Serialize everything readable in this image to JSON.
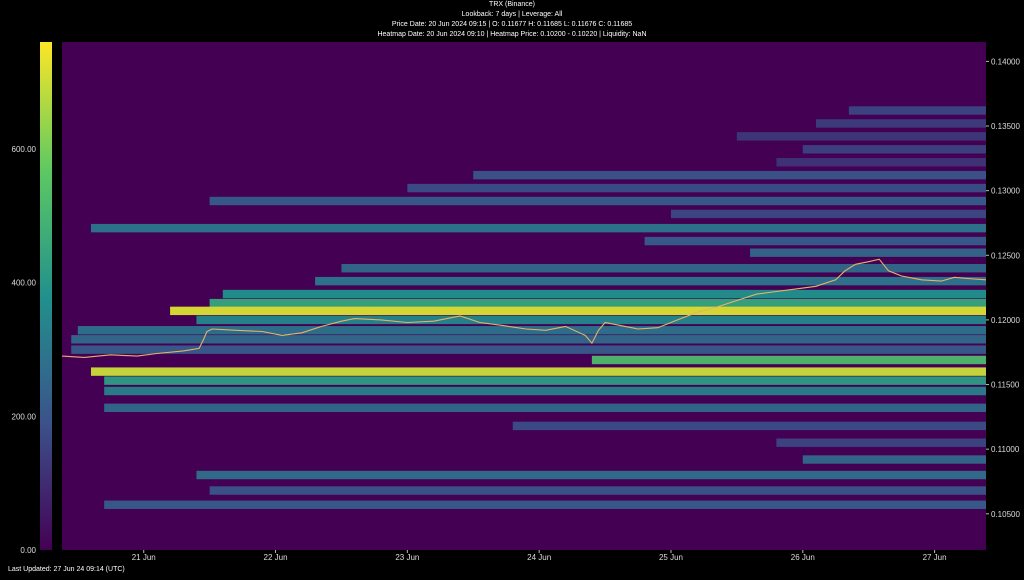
{
  "header": {
    "title": "TRX (Binance)",
    "subtitle": "Lookback: 7 days | Leverage: All",
    "price_line": "Price Date: 20 Jun 2024 09:15 | O: 0.11677 H: 0.11685 L: 0.11676 C: 0.11685",
    "heatmap_line": "Heatmap Date: 20 Jun 2024 09:10 | Heatmap Price: 0.10200 - 0.10220 | Liquidity: NaN"
  },
  "footer": {
    "last_updated": "Last Updated: 27 Jun 24 09:14 (UTC)"
  },
  "colors": {
    "background": "#440154",
    "price_line": "#e8b26a",
    "panel": "#000000"
  },
  "chart_data": {
    "type": "heatmap",
    "title": "TRX (Binance)",
    "xlabel": "",
    "ylabel": "",
    "x_ticks": [
      "21 Jun",
      "22 Jun",
      "23 Jun",
      "24 Jun",
      "25 Jun",
      "26 Jun",
      "27 Jun"
    ],
    "x_range_days": [
      20.38,
      27.39
    ],
    "ylim": [
      0.1022,
      0.1415
    ],
    "y_ticks": [
      "0.14000",
      "0.13500",
      "0.13000",
      "0.12500",
      "0.12000",
      "0.11500",
      "0.11000",
      "0.10500"
    ],
    "colorbar": {
      "range": [
        0,
        760
      ],
      "ticks": [
        "0.00",
        "200.00",
        "400.00",
        "600.00"
      ],
      "colormap": "viridis"
    },
    "price_series": {
      "x": [
        20.38,
        20.55,
        20.75,
        20.95,
        21.1,
        21.3,
        21.42,
        21.45,
        21.48,
        21.52,
        21.7,
        21.9,
        22.05,
        22.2,
        22.35,
        22.5,
        22.6,
        22.8,
        23.0,
        23.2,
        23.4,
        23.55,
        23.7,
        23.9,
        24.05,
        24.2,
        24.35,
        24.4,
        24.45,
        24.5,
        24.6,
        24.75,
        24.9,
        25.05,
        25.2,
        25.35,
        25.5,
        25.65,
        25.8,
        25.95,
        26.1,
        26.25,
        26.32,
        26.4,
        26.5,
        26.58,
        26.65,
        26.75,
        26.9,
        27.05,
        27.15,
        27.25,
        27.39
      ],
      "y": [
        0.1172,
        0.1171,
        0.1173,
        0.1172,
        0.1174,
        0.1176,
        0.1178,
        0.1184,
        0.1191,
        0.1193,
        0.1192,
        0.1191,
        0.1188,
        0.119,
        0.1195,
        0.1199,
        0.1201,
        0.12,
        0.1198,
        0.1199,
        0.1203,
        0.1198,
        0.1196,
        0.1193,
        0.1192,
        0.1195,
        0.1188,
        0.1182,
        0.1192,
        0.1198,
        0.1196,
        0.1193,
        0.1194,
        0.12,
        0.1206,
        0.121,
        0.1215,
        0.122,
        0.1222,
        0.1224,
        0.1226,
        0.1231,
        0.1238,
        0.1243,
        0.1245,
        0.1247,
        0.1238,
        0.1234,
        0.1231,
        0.123,
        0.1233,
        0.1232,
        0.1231
      ]
    },
    "liquidity_bands": [
      {
        "price": 0.1362,
        "start": 26.35,
        "value": 160
      },
      {
        "price": 0.1352,
        "start": 26.1,
        "value": 140
      },
      {
        "price": 0.1342,
        "start": 25.5,
        "value": 130
      },
      {
        "price": 0.1332,
        "start": 26.0,
        "value": 150
      },
      {
        "price": 0.1322,
        "start": 25.8,
        "value": 120
      },
      {
        "price": 0.1312,
        "start": 23.5,
        "value": 200
      },
      {
        "price": 0.1302,
        "start": 23.0,
        "value": 180
      },
      {
        "price": 0.1292,
        "start": 21.5,
        "value": 220
      },
      {
        "price": 0.1282,
        "start": 25.0,
        "value": 170
      },
      {
        "price": 0.1271,
        "start": 20.6,
        "value": 300
      },
      {
        "price": 0.1261,
        "start": 24.8,
        "value": 220
      },
      {
        "price": 0.1252,
        "start": 25.6,
        "value": 250
      },
      {
        "price": 0.124,
        "start": 22.5,
        "value": 260
      },
      {
        "price": 0.123,
        "start": 22.3,
        "value": 300
      },
      {
        "price": 0.122,
        "start": 21.6,
        "value": 380
      },
      {
        "price": 0.1213,
        "start": 21.5,
        "value": 450
      },
      {
        "price": 0.1207,
        "start": 21.2,
        "value": 720
      },
      {
        "price": 0.12,
        "start": 21.4,
        "value": 350
      },
      {
        "price": 0.1192,
        "start": 20.5,
        "value": 290
      },
      {
        "price": 0.1185,
        "start": 20.45,
        "value": 260
      },
      {
        "price": 0.1177,
        "start": 20.45,
        "value": 220
      },
      {
        "price": 0.1169,
        "start": 24.4,
        "value": 520
      },
      {
        "price": 0.116,
        "start": 20.6,
        "value": 700
      },
      {
        "price": 0.1153,
        "start": 20.7,
        "value": 420
      },
      {
        "price": 0.1145,
        "start": 20.7,
        "value": 330
      },
      {
        "price": 0.1132,
        "start": 20.7,
        "value": 260
      },
      {
        "price": 0.1118,
        "start": 23.8,
        "value": 180
      },
      {
        "price": 0.1105,
        "start": 25.8,
        "value": 160
      },
      {
        "price": 0.1092,
        "start": 26.0,
        "value": 260
      },
      {
        "price": 0.108,
        "start": 21.4,
        "value": 280
      },
      {
        "price": 0.1068,
        "start": 21.5,
        "value": 200
      },
      {
        "price": 0.1057,
        "start": 20.7,
        "value": 220
      }
    ]
  }
}
